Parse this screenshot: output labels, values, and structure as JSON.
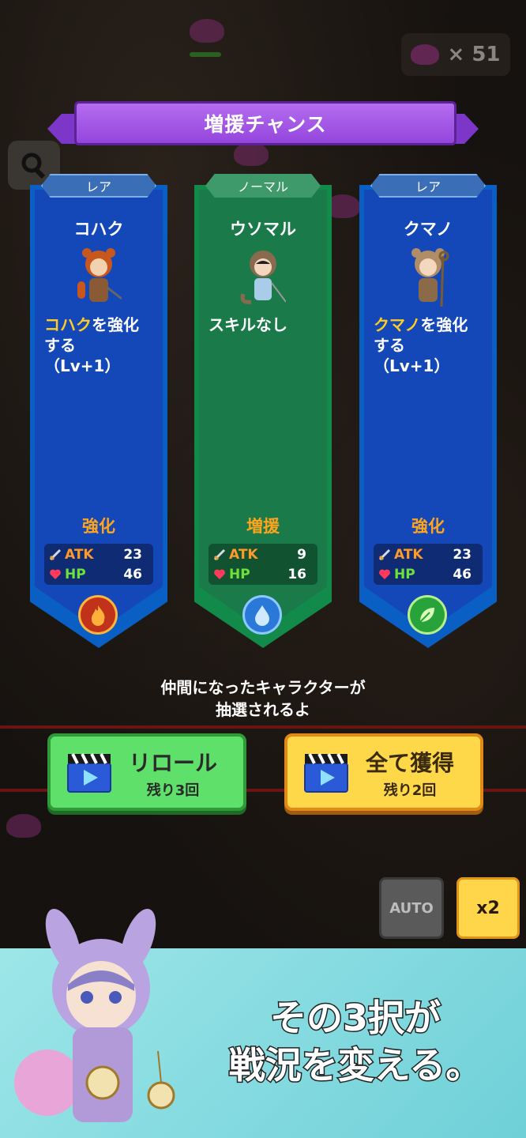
{
  "hud": {
    "enemy_count": "× 51"
  },
  "banner": {
    "title": "増援チャンス"
  },
  "cards": [
    {
      "rarity": "レア",
      "name": "コハク",
      "desc_highlight": "コハク",
      "desc_line1_rest": "を強化",
      "desc_line2": "する",
      "desc_line3": "（Lv+1）",
      "kind": "強化",
      "atk_label": "ATK",
      "atk": "23",
      "hp_label": "HP",
      "hp": "46",
      "element_icon": "fire-icon"
    },
    {
      "rarity": "ノーマル",
      "name": "ウソマル",
      "desc_plain": "スキルなし",
      "kind": "増援",
      "atk_label": "ATK",
      "atk": "9",
      "hp_label": "HP",
      "hp": "16",
      "element_icon": "water-icon"
    },
    {
      "rarity": "レア",
      "name": "クマノ",
      "desc_highlight": "クマノ",
      "desc_line1_rest": "を強化",
      "desc_line2": "する",
      "desc_line3": "（Lv+1）",
      "kind": "強化",
      "atk_label": "ATK",
      "atk": "23",
      "hp_label": "HP",
      "hp": "46",
      "element_icon": "leaf-icon"
    }
  ],
  "caption": {
    "line1": "仲間になったキャラクターが",
    "line2": "抽選されるよ"
  },
  "reroll": {
    "label": "リロール",
    "remaining": "残り3回"
  },
  "get_all": {
    "label": "全て獲得",
    "remaining": "残り2回"
  },
  "controls": {
    "auto_label": "AUTO",
    "speed_label": "x2"
  },
  "promo": {
    "line1": "その3択が",
    "line2": "戦況を変える。"
  },
  "colors": {
    "rare_card": "#1448b8",
    "normal_card": "#1b7a4a",
    "highlight": "#ffcc22",
    "kind": "#ffa41c"
  }
}
